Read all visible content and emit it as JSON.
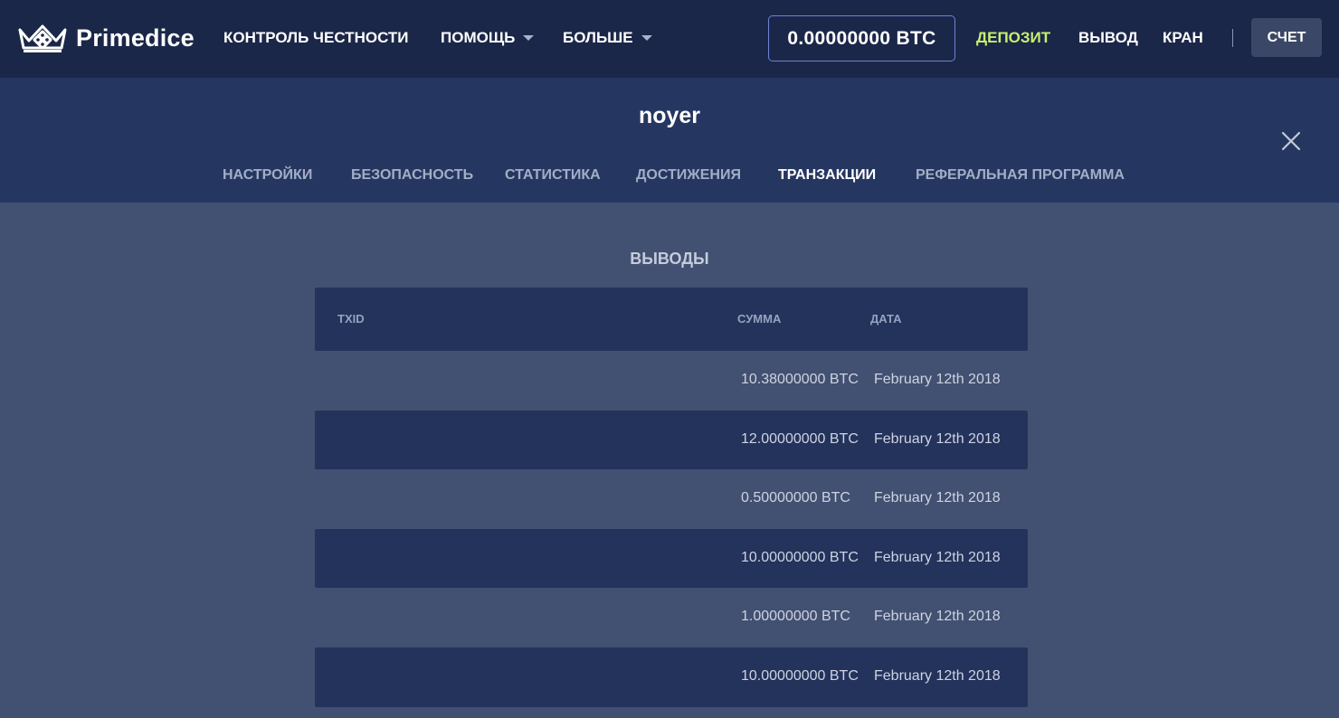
{
  "brand": {
    "name": "Primedice"
  },
  "nav": {
    "fairness": "КОНТРОЛЬ ЧЕСТНОСТИ",
    "help": "ПОМОЩЬ",
    "more": "БОЛЬШЕ",
    "balance": "0.00000000 BTC",
    "deposit": "ДЕПОЗИТ",
    "withdraw": "ВЫВОД",
    "faucet": "КРАН",
    "account": "СЧЕТ"
  },
  "colors": {
    "topbar": "#1b2748",
    "header": "#253761",
    "page": "#425071",
    "accent_deposit": "#c9ee70",
    "balance_border": "#6d83d8"
  },
  "profile": {
    "username": "noyer",
    "tabs": [
      {
        "label": "НАСТРОЙКИ"
      },
      {
        "label": "БЕЗОПАСНОСТЬ"
      },
      {
        "label": "СТАТИСТИКА"
      },
      {
        "label": "ДОСТИЖЕНИЯ"
      },
      {
        "label": "ТРАНЗАКЦИИ"
      },
      {
        "label": "РЕФЕРАЛЬНАЯ ПРОГРАММА"
      }
    ],
    "active_tab": "ТРАНЗАКЦИИ"
  },
  "withdrawals": {
    "title": "ВЫВОДЫ",
    "columns": [
      "TXID",
      "СУММА",
      "ДАТА"
    ],
    "rows": [
      {
        "txid": "",
        "amount": "10.38000000 BTC",
        "date": "February 12th 2018"
      },
      {
        "txid": "",
        "amount": "12.00000000 BTC",
        "date": "February 12th 2018"
      },
      {
        "txid": "",
        "amount": "0.50000000 BTC",
        "date": "February 12th 2018"
      },
      {
        "txid": "",
        "amount": "10.00000000 BTC",
        "date": "February 12th 2018"
      },
      {
        "txid": "",
        "amount": "1.00000000 BTC",
        "date": "February 12th 2018"
      },
      {
        "txid": "",
        "amount": "10.00000000 BTC",
        "date": "February 12th 2018"
      }
    ]
  }
}
